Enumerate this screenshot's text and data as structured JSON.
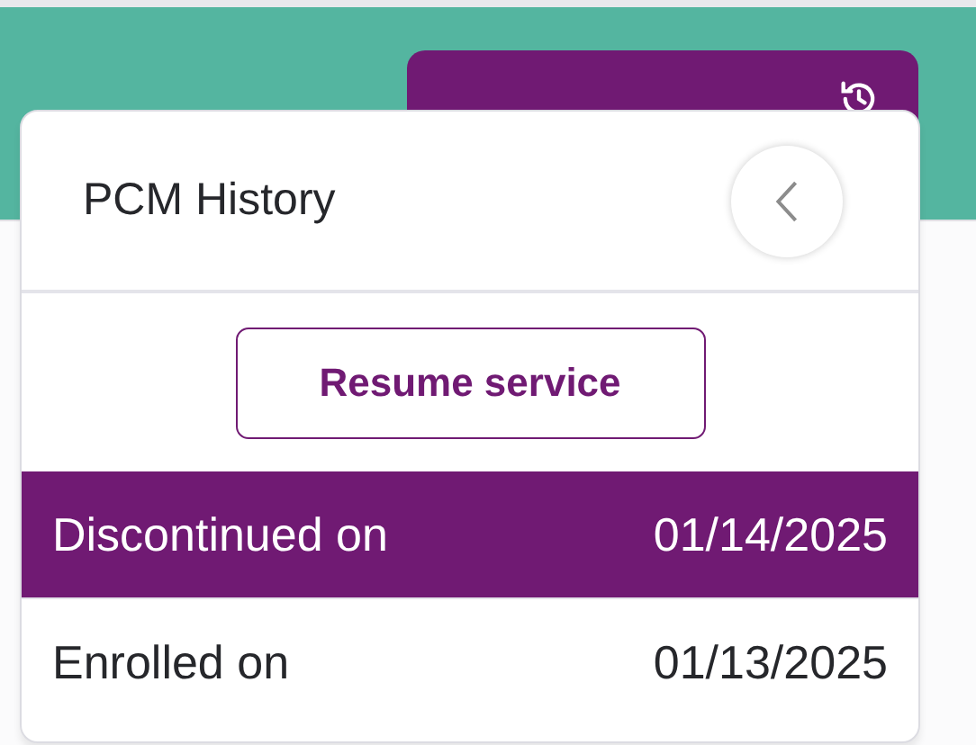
{
  "popover": {
    "title": "PCM History",
    "action": "Resume service",
    "rows": [
      {
        "label": "Discontinued on",
        "date": "01/14/2025",
        "selected": true
      },
      {
        "label": "Enrolled on",
        "date": "01/13/2025",
        "selected": false
      }
    ]
  }
}
